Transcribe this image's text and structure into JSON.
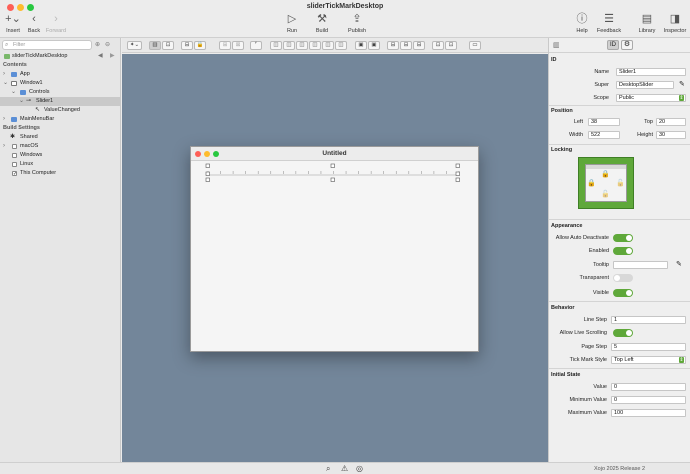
{
  "window": {
    "title": "sliderTickMarkDesktop"
  },
  "toolbar": {
    "insert": {
      "icon": "plus-chevron-icon",
      "label": "Insert"
    },
    "back": {
      "icon": "chevron-left-icon",
      "label": "Back"
    },
    "forward": {
      "icon": "chevron-right-icon",
      "label": "Forward"
    },
    "run": {
      "icon": "play-icon",
      "label": "Run"
    },
    "build": {
      "icon": "hammer-icon",
      "label": "Build"
    },
    "publish": {
      "icon": "publish-icon",
      "label": "Publish"
    },
    "help": {
      "icon": "question-icon",
      "label": "Help"
    },
    "feedback": {
      "icon": "feedback-icon",
      "label": "Feedback"
    },
    "library": {
      "icon": "library-icon",
      "label": "Library"
    },
    "inspector": {
      "icon": "inspector-icon",
      "label": "Inspector"
    }
  },
  "navigator": {
    "filter_placeholder": "Filter",
    "project_name": "sliderTickMarkDesktop",
    "contents_header": "Contents",
    "items": {
      "app": "App",
      "window1": "Window1",
      "controls": "Controls",
      "slider1": "Slider1",
      "value_changed": "ValueChanged",
      "main_menu_bar": "MainMenuBar"
    },
    "build_settings_header": "Build Settings",
    "build": {
      "shared": "Shared",
      "macos": "macOS",
      "windows": "Windows",
      "linux": "Linux",
      "this_computer": "This Computer"
    }
  },
  "canvas": {
    "window_title": "Untitled"
  },
  "inspector": {
    "id_section": "ID",
    "name_label": "Name",
    "name_value": "Slider1",
    "super_label": "Super",
    "super_value": "DesktopSlider",
    "scope_label": "Scope",
    "scope_value": "Public",
    "position_section": "Position",
    "left_label": "Left",
    "left_value": "38",
    "top_label": "Top",
    "top_value": "20",
    "width_label": "Width",
    "width_value": "522",
    "height_label": "Height",
    "height_value": "30",
    "locking_section": "Locking",
    "appearance_section": "Appearance",
    "allow_auto_deactivate_label": "Allow Auto Deactivate",
    "enabled_label": "Enabled",
    "tooltip_label": "Tooltip",
    "transparent_label": "Transparent",
    "visible_label": "Visible",
    "behavior_section": "Behavior",
    "line_step_label": "Line Step",
    "line_step_value": "1",
    "allow_live_scrolling_label": "Allow Live Scrolling",
    "page_step_label": "Page Step",
    "page_step_value": "5",
    "tick_mark_style_label": "Tick Mark Style",
    "tick_mark_style_value": "Top Left",
    "initial_state_section": "Initial State",
    "value_label": "Value",
    "value_value": "0",
    "minimum_value_label": "Minimum Value",
    "minimum_value_value": "0",
    "maximum_value_label": "Maximum Value",
    "maximum_value_value": "100"
  },
  "status": {
    "version": "Xojo 2025 Release 2"
  },
  "colors": {
    "canvas_bg": "#73869a",
    "toggle_on": "#5fa83a",
    "locking_green": "#5fa83a",
    "selection": "#c9c9c9"
  }
}
